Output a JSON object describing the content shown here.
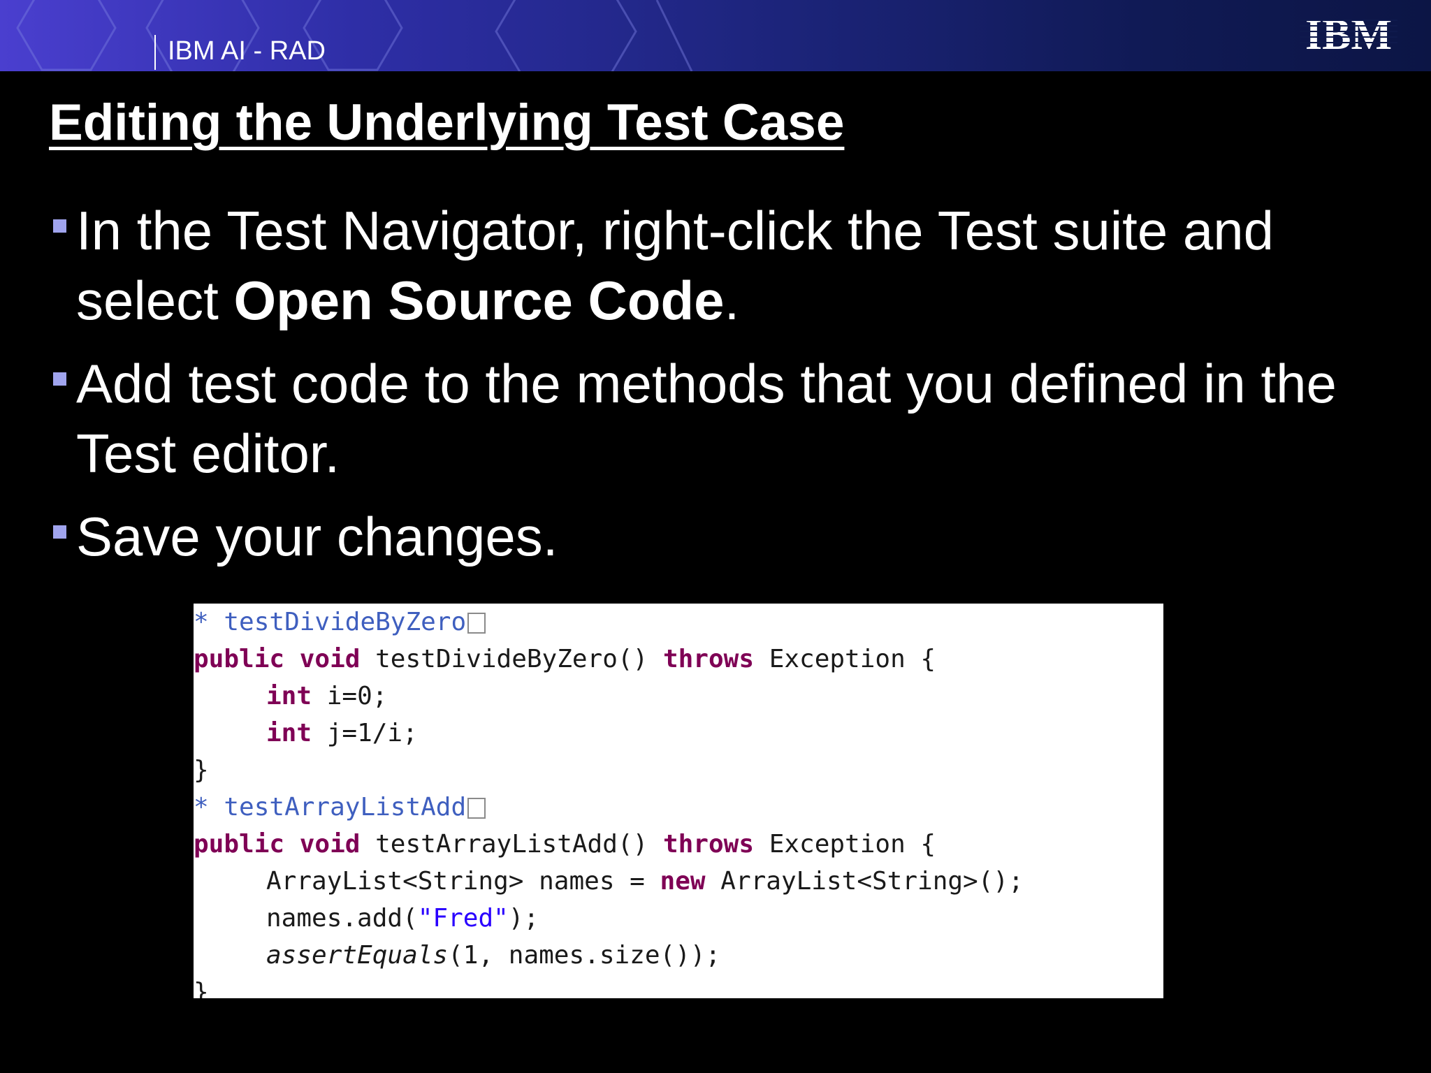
{
  "header": {
    "title": "IBM AI - RAD",
    "logo_text": "IBM",
    "colors": {
      "gradient_start": "#4a3fcf",
      "gradient_end": "#0c1545"
    }
  },
  "slide": {
    "title": "Editing the Underlying Test Case",
    "bullets": [
      {
        "text_before": "In the Test Navigator, right-click the Test suite and select ",
        "bold": "Open Source Code",
        "text_after": "."
      },
      {
        "text": "Add test code to the methods that you defined in the Test editor."
      },
      {
        "text": "Save your changes."
      }
    ],
    "bullet_color": "#a0a4ee"
  },
  "code": {
    "comment1_star": "*",
    "comment1_name": "testDivideByZero",
    "l2_public": "public",
    "l2_void": "void",
    "l2_sig": "testDivideByZero()",
    "l2_throws": "throws",
    "l2_exc": "Exception {",
    "l3_int": "int",
    "l3_rest": "i=0;",
    "l4_int": "int",
    "l4_rest": "j=1/i;",
    "l5_brace": "}",
    "comment2_star": "*",
    "comment2_name": "testArrayListAdd",
    "l7_public": "public",
    "l7_void": "void",
    "l7_sig": "testArrayListAdd()",
    "l7_throws": "throws",
    "l7_exc": "Exception {",
    "l8_a": "ArrayList<String> names =",
    "l8_new": "new",
    "l8_b": "ArrayList<String>();",
    "l9_a": "names.add(",
    "l9_str": "\"Fred\"",
    "l9_b": ");",
    "l10_a": "assertEquals",
    "l10_b": "(1, names.size());",
    "l11_brace": "}",
    "colors": {
      "keyword": "#7f0055",
      "comment": "#3f5fbf",
      "string": "#2a00ff"
    }
  }
}
